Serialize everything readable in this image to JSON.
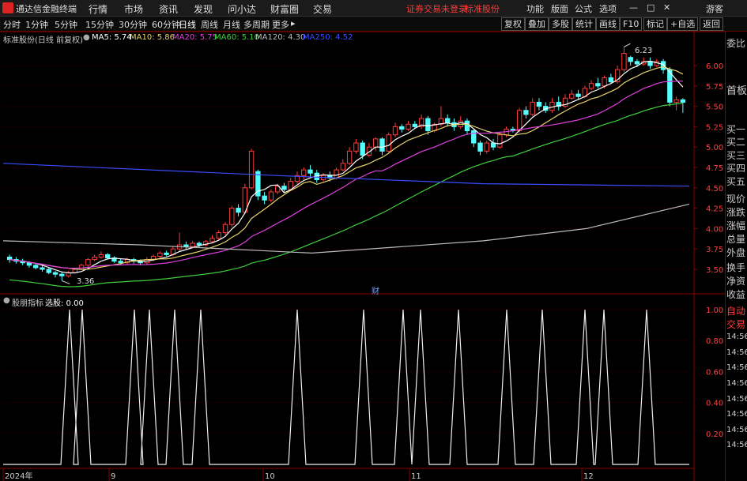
{
  "titlebar": {
    "app_name": "通达信金融终端",
    "menus": [
      "行情",
      "市场",
      "资讯",
      "发现",
      "问小达",
      "财富圈",
      "交易"
    ],
    "login_notice": "证券交易未登录",
    "stock_name": "标准股份",
    "right_menus": [
      "功能",
      "版面",
      "公式",
      "选项"
    ],
    "user": "游客",
    "win_min": "—",
    "win_max": "□",
    "win_close": "✕"
  },
  "toolbar": {
    "periods": [
      "分时",
      "1分钟",
      "5分钟",
      "15分钟",
      "30分钟",
      "60分钟",
      "日线",
      "周线",
      "月线",
      "多周期",
      "更多"
    ],
    "active_period": "日线",
    "more_arrow": "▸",
    "buttons": [
      "复权",
      "叠加",
      "多股",
      "统计",
      "画线",
      "F10",
      "标记",
      "+自选",
      "返回"
    ]
  },
  "legend": {
    "title": "标准股份(日线 前复权)",
    "items": [
      {
        "label": "MA5: 5.74",
        "color": "#ffffff"
      },
      {
        "label": "MA10: 5.86",
        "color": "#e6d36b"
      },
      {
        "label": "MA20: 5.75",
        "color": "#e040e0"
      },
      {
        "label": "MA60: 5.10",
        "color": "#3ecf3e"
      },
      {
        "label": "MA120: 4.30",
        "color": "#bbbbbb"
      },
      {
        "label": "MA250: 4.52",
        "color": "#3b4cff"
      }
    ]
  },
  "price_axis": [
    "6.00",
    "5.75",
    "5.50",
    "5.25",
    "5.00",
    "4.75",
    "4.50",
    "4.25",
    "4.00",
    "3.75",
    "3.50"
  ],
  "annotations": {
    "high": "6.23",
    "low": "3.36",
    "fin_marker": "财"
  },
  "indicator": {
    "title": "股朋指标",
    "value_label": "选股: 0.00",
    "axis": [
      "1.00",
      "0.80",
      "0.60",
      "0.40",
      "0.20"
    ]
  },
  "time_axis": [
    "2024年",
    "9",
    "10",
    "11",
    "12"
  ],
  "right_panel": {
    "top": [
      "委比",
      "首板"
    ],
    "mid": [
      "买一",
      "买二",
      "买三",
      "买四",
      "买五",
      "现价",
      "涨跌",
      "涨幅",
      "总量",
      "外盘",
      "换手",
      "净资",
      "收益"
    ],
    "bottom": [
      "自动",
      "交易"
    ],
    "ticks": [
      "14:56",
      "14:56",
      "14:56",
      "14:56",
      "14:56",
      "14:56",
      "14:56",
      "14:56"
    ]
  },
  "colors": {
    "up": "#ff3b3b",
    "down": "#54ffff",
    "grid": "#8a0000",
    "accent": "#ff3b3b"
  },
  "chart_data": {
    "type": "candlestick",
    "y_range": [
      3.4,
      6.25
    ],
    "candles": [
      [
        3.65,
        3.62,
        3.68,
        3.58
      ],
      [
        3.62,
        3.6,
        3.65,
        3.57
      ],
      [
        3.6,
        3.58,
        3.63,
        3.55
      ],
      [
        3.58,
        3.55,
        3.6,
        3.52
      ],
      [
        3.55,
        3.52,
        3.58,
        3.5
      ],
      [
        3.52,
        3.5,
        3.55,
        3.47
      ],
      [
        3.5,
        3.46,
        3.52,
        3.44
      ],
      [
        3.46,
        3.44,
        3.48,
        3.4
      ],
      [
        3.44,
        3.42,
        3.47,
        3.36
      ],
      [
        3.42,
        3.46,
        3.48,
        3.4
      ],
      [
        3.46,
        3.5,
        3.52,
        3.45
      ],
      [
        3.5,
        3.55,
        3.57,
        3.49
      ],
      [
        3.55,
        3.62,
        3.64,
        3.53
      ],
      [
        3.62,
        3.65,
        3.68,
        3.6
      ],
      [
        3.65,
        3.68,
        3.72,
        3.63
      ],
      [
        3.68,
        3.64,
        3.7,
        3.62
      ],
      [
        3.64,
        3.6,
        3.66,
        3.58
      ],
      [
        3.6,
        3.58,
        3.63,
        3.55
      ],
      [
        3.58,
        3.62,
        3.64,
        3.56
      ],
      [
        3.62,
        3.6,
        3.64,
        3.57
      ],
      [
        3.6,
        3.58,
        3.62,
        3.55
      ],
      [
        3.58,
        3.62,
        3.65,
        3.56
      ],
      [
        3.62,
        3.66,
        3.68,
        3.6
      ],
      [
        3.66,
        3.7,
        3.72,
        3.64
      ],
      [
        3.7,
        3.68,
        3.73,
        3.66
      ],
      [
        3.68,
        3.75,
        3.78,
        3.66
      ],
      [
        3.75,
        3.8,
        3.95,
        3.72
      ],
      [
        3.8,
        3.78,
        3.84,
        3.75
      ],
      [
        3.78,
        3.82,
        3.85,
        3.76
      ],
      [
        3.82,
        3.8,
        3.84,
        3.77
      ],
      [
        3.8,
        3.84,
        3.86,
        3.78
      ],
      [
        3.84,
        3.88,
        3.92,
        3.82
      ],
      [
        3.88,
        3.95,
        3.98,
        3.86
      ],
      [
        3.95,
        4.05,
        4.08,
        3.92
      ],
      [
        4.05,
        4.25,
        4.28,
        4.02
      ],
      [
        4.25,
        4.2,
        4.3,
        4.15
      ],
      [
        4.2,
        4.5,
        4.55,
        4.18
      ],
      [
        4.5,
        4.95,
        4.98,
        4.48
      ],
      [
        4.7,
        4.4,
        4.72,
        4.35
      ],
      [
        4.4,
        4.35,
        4.45,
        4.3
      ],
      [
        4.35,
        4.45,
        4.48,
        4.32
      ],
      [
        4.45,
        4.52,
        4.55,
        4.42
      ],
      [
        4.52,
        4.48,
        4.56,
        4.45
      ],
      [
        4.48,
        4.58,
        4.62,
        4.46
      ],
      [
        4.58,
        4.65,
        4.7,
        4.55
      ],
      [
        4.65,
        4.72,
        4.75,
        4.6
      ],
      [
        4.72,
        4.68,
        4.78,
        4.62
      ],
      [
        4.68,
        4.6,
        4.72,
        4.56
      ],
      [
        4.6,
        4.65,
        4.68,
        4.58
      ],
      [
        4.65,
        4.62,
        4.7,
        4.58
      ],
      [
        4.62,
        4.72,
        4.75,
        4.6
      ],
      [
        4.72,
        4.8,
        4.85,
        4.7
      ],
      [
        4.8,
        4.95,
        5.0,
        4.78
      ],
      [
        4.95,
        5.05,
        5.1,
        4.92
      ],
      [
        5.05,
        4.9,
        5.08,
        4.85
      ],
      [
        4.9,
        5.0,
        5.05,
        4.88
      ],
      [
        5.0,
        5.1,
        5.12,
        4.95
      ],
      [
        5.1,
        4.95,
        5.12,
        4.9
      ],
      [
        4.95,
        5.15,
        5.18,
        4.92
      ],
      [
        5.15,
        5.25,
        5.3,
        5.12
      ],
      [
        5.25,
        5.22,
        5.28,
        5.18
      ],
      [
        5.22,
        5.28,
        5.32,
        5.2
      ],
      [
        5.28,
        5.25,
        5.32,
        5.22
      ],
      [
        5.25,
        5.35,
        5.4,
        5.22
      ],
      [
        5.35,
        5.2,
        5.38,
        5.15
      ],
      [
        5.2,
        5.28,
        5.3,
        5.18
      ],
      [
        5.28,
        5.35,
        5.5,
        5.25
      ],
      [
        5.35,
        5.3,
        5.4,
        5.25
      ],
      [
        5.3,
        5.25,
        5.35,
        5.2
      ],
      [
        5.25,
        5.32,
        5.38,
        5.22
      ],
      [
        5.32,
        5.2,
        5.35,
        5.15
      ],
      [
        5.2,
        5.05,
        5.22,
        5.0
      ],
      [
        5.05,
        4.95,
        5.08,
        4.9
      ],
      [
        4.95,
        5.05,
        5.08,
        4.92
      ],
      [
        5.05,
        5.0,
        5.1,
        4.96
      ],
      [
        5.0,
        5.15,
        5.18,
        4.98
      ],
      [
        5.15,
        5.22,
        5.25,
        5.12
      ],
      [
        5.22,
        5.2,
        5.25,
        5.18
      ],
      [
        5.2,
        5.45,
        5.48,
        5.18
      ],
      [
        5.45,
        5.4,
        5.5,
        5.35
      ],
      [
        5.4,
        5.55,
        5.6,
        5.38
      ],
      [
        5.55,
        5.5,
        5.6,
        5.45
      ],
      [
        5.5,
        5.45,
        5.55,
        5.42
      ],
      [
        5.45,
        5.55,
        5.6,
        5.42
      ],
      [
        5.55,
        5.5,
        5.62,
        5.45
      ],
      [
        5.5,
        5.6,
        5.65,
        5.48
      ],
      [
        5.6,
        5.65,
        5.7,
        5.58
      ],
      [
        5.65,
        5.62,
        5.7,
        5.58
      ],
      [
        5.62,
        5.72,
        5.75,
        5.6
      ],
      [
        5.72,
        5.78,
        5.82,
        5.7
      ],
      [
        5.78,
        5.75,
        5.85,
        5.72
      ],
      [
        5.75,
        5.85,
        5.88,
        5.72
      ],
      [
        5.85,
        5.8,
        5.9,
        5.78
      ],
      [
        5.8,
        5.95,
        6.0,
        5.78
      ],
      [
        5.95,
        6.15,
        6.23,
        5.92
      ],
      [
        6.1,
        6.05,
        6.12,
        6.0
      ],
      [
        6.05,
        6.02,
        6.08,
        5.98
      ],
      [
        6.02,
        6.05,
        6.1,
        6.0
      ],
      [
        6.05,
        6.0,
        6.1,
        5.96
      ],
      [
        6.0,
        6.05,
        6.08,
        5.98
      ],
      [
        6.05,
        5.95,
        6.08,
        5.9
      ],
      [
        5.95,
        5.55,
        5.98,
        5.5
      ],
      [
        5.55,
        5.58,
        5.62,
        5.45
      ],
      [
        5.58,
        5.55,
        5.6,
        5.42
      ]
    ],
    "ma250": [
      [
        4.8,
        0.0
      ],
      [
        4.65,
        0.4
      ],
      [
        4.55,
        0.7
      ],
      [
        4.52,
        1.0
      ]
    ],
    "ma120": [
      [
        3.85,
        0.0
      ],
      [
        3.8,
        0.2
      ],
      [
        3.7,
        0.45
      ],
      [
        3.85,
        0.7
      ],
      [
        4.0,
        0.85
      ],
      [
        4.3,
        1.0
      ]
    ],
    "indicator_series": "spikes"
  }
}
